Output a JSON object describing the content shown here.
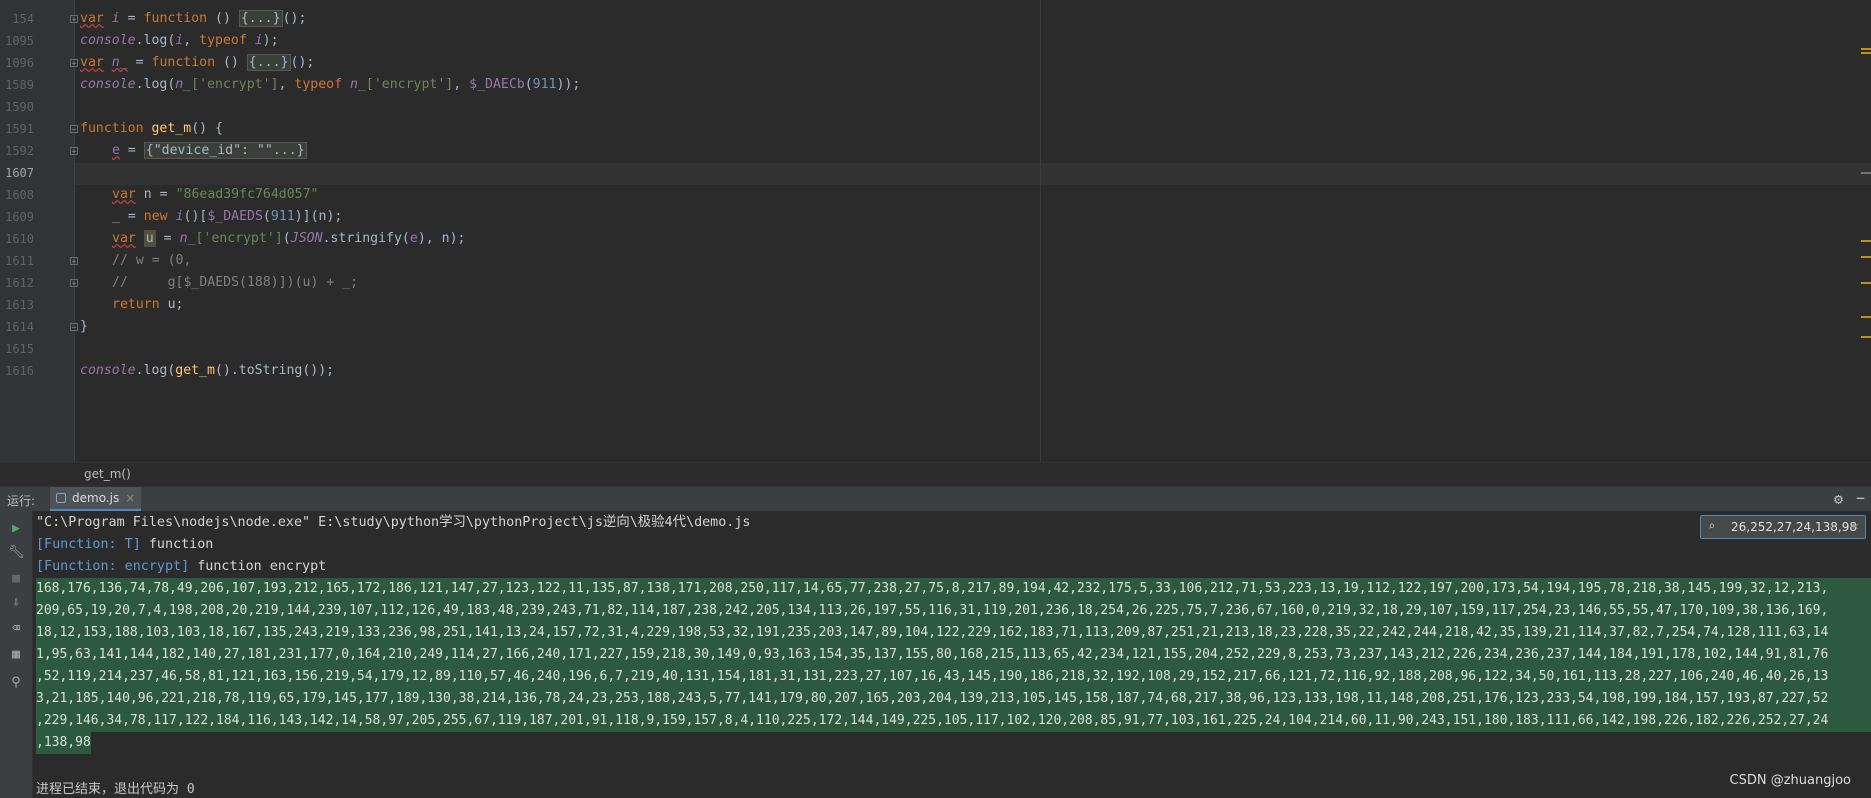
{
  "editor": {
    "line_numbers": [
      "154",
      "1095",
      "1096",
      "1589",
      "1590",
      "1591",
      "1592",
      "1607",
      "1608",
      "1609",
      "1610",
      "1611",
      "1612",
      "1613",
      "1614",
      "1615",
      "1616"
    ],
    "current_line": "1607",
    "code": {
      "l154": {
        "kw": "var",
        "v": "i",
        "eq": " = ",
        "fn": "function",
        "rest": " () ",
        "fold": "{...}",
        "end": "();"
      },
      "l1095": {
        "console": "console",
        "log": ".log(",
        "a": "i",
        "sep": ", ",
        "typeof": "typeof",
        "b": "i",
        "end": ");"
      },
      "l1096": {
        "kw": "var",
        "v": "n_",
        "eq": " = ",
        "fn": "function",
        "rest": " () ",
        "fold": "{...}",
        "end": "();"
      },
      "l1589": {
        "console": "console",
        "log": ".log(",
        "a": "n_",
        "s1": "['encrypt']",
        "sep": ", ",
        "typeof": "typeof",
        "b": "n_",
        "s2": "['encrypt']",
        "sep2": ", ",
        "fnname": "$_DAECb",
        "p1": "(",
        "num": "911",
        "end": "));"
      },
      "l1591": {
        "fn": "function",
        "name": "get_m",
        "rest": "() {"
      },
      "l1592": {
        "v": "e",
        "eq": " = ",
        "fold": "{\"device_id\": \"\"...}"
      },
      "l1608": {
        "kw": "var",
        "v": "n",
        "eq": " = ",
        "str": "\"86ead39fc764d057\""
      },
      "l1609": {
        "v": "_",
        "eq": " = ",
        "new": "new",
        "i": "i",
        "p1": "()[",
        "fnname": "$_DAEDS",
        "p2": "(",
        "num": "911",
        "p3": ")](n);"
      },
      "l1610": {
        "kw": "var",
        "v": "u",
        "eq": " = ",
        "n": "n_",
        "str": "['encrypt']",
        "p1": "(",
        "json": "JSON",
        "rest": ".stringify(",
        "e": "e",
        "end": "), n);"
      },
      "l1611": {
        "comment": "// w = (0,"
      },
      "l1612": {
        "comment": "//     g[$_DAEDS(188)])(u) + _;"
      },
      "l1613": {
        "ret": "return",
        "rest": " u;"
      },
      "l1614": {
        "brace": "}"
      },
      "l1616": {
        "console": "console",
        "log": ".log(",
        "call": "get_m",
        "rest": "().toString());"
      }
    }
  },
  "breadcrumb": "get_m()",
  "run": {
    "label": "运行:",
    "tab_label": "demo.js",
    "close": "×"
  },
  "console": {
    "command": "\"C:\\Program Files\\nodejs\\node.exe\" E:\\study\\python学习\\pythonProject\\js逆向\\极验4代\\demo.js",
    "line2_fn": "[Function: T]",
    "line2_rest": " function",
    "line3_fn": "[Function: encrypt]",
    "line3_rest": " function encrypt",
    "output_lines": [
      "168,176,136,74,78,49,206,107,193,212,165,172,186,121,147,27,123,122,11,135,87,138,171,208,250,117,14,65,77,238,27,75,8,217,89,194,42,232,175,5,33,106,212,71,53,223,13,19,112,122,197,200,173,54,194,195,78,218,38,145,199,32,12,213,",
      "209,65,19,20,7,4,198,208,20,219,144,239,107,112,126,49,183,48,239,243,71,82,114,187,238,242,205,134,113,26,197,55,116,31,119,201,236,18,254,26,225,75,7,236,67,160,0,219,32,18,29,107,159,117,254,23,146,55,55,47,170,109,38,136,169,",
      "18,12,153,188,103,103,18,167,135,243,219,133,236,98,251,141,13,24,157,72,31,4,229,198,53,32,191,235,203,147,89,104,122,229,162,183,71,113,209,87,251,21,213,18,23,228,35,22,242,244,218,42,35,139,21,114,37,82,7,254,74,128,111,63,14",
      "1,95,63,141,144,182,140,27,181,231,177,0,164,210,249,114,27,166,240,171,227,159,218,30,149,0,93,163,154,35,137,155,80,168,215,113,65,42,234,121,155,204,252,229,8,253,73,237,143,212,226,234,236,237,144,184,191,178,102,144,91,81,76",
      ",52,119,214,237,46,58,81,121,163,156,219,54,179,12,89,110,57,46,240,196,6,7,219,40,131,154,181,31,131,223,27,107,16,43,145,190,186,218,32,192,108,29,152,217,66,121,72,116,92,188,208,96,122,34,50,161,113,28,227,106,240,46,40,26,13",
      "3,21,185,140,96,221,218,78,119,65,179,145,177,189,130,38,214,136,78,24,23,253,188,243,5,77,141,179,80,207,165,203,204,139,213,105,145,158,187,74,68,217,38,96,123,133,198,11,148,208,251,176,123,233,54,198,199,184,157,193,87,227,52",
      ",229,146,34,78,117,122,184,116,143,142,14,58,97,205,255,67,119,187,201,91,118,9,159,157,8,4,110,225,172,144,149,225,105,117,102,120,208,85,91,77,103,161,225,24,104,214,60,11,90,243,151,180,183,111,66,142,198,226,182,226,252,27,24",
      ",138,98"
    ],
    "exit_message": "进程已结束，退出代码为 0"
  },
  "search": {
    "value": "26,252,27,24,138,98",
    "icon": "search-icon"
  },
  "watermark": "CSDN @zhuangjoo",
  "colors": {
    "background": "#2b2b2b",
    "keyword": "#cc7832",
    "string": "#6a8759",
    "number": "#6897bb",
    "highlight": "#2d593e",
    "accent": "#4a88c7"
  }
}
